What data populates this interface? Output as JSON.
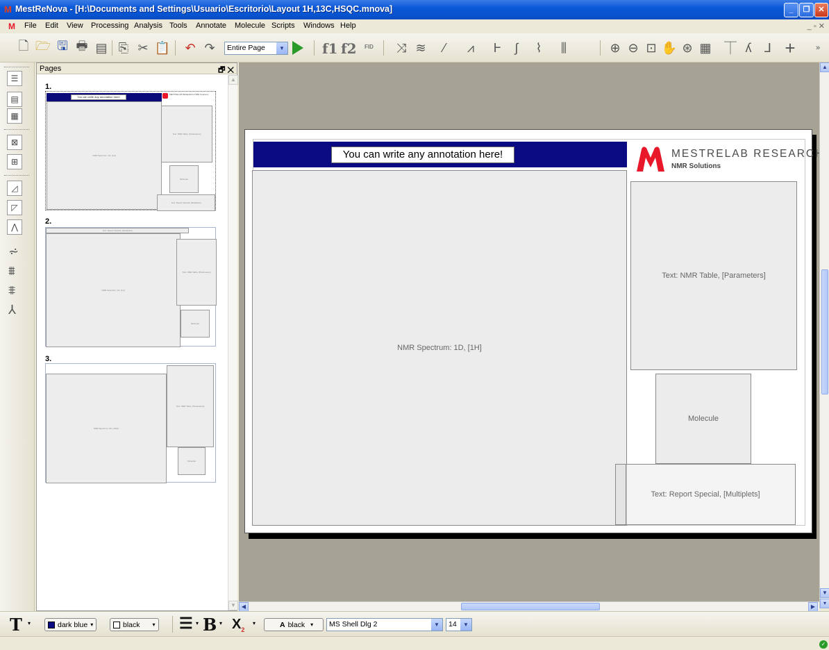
{
  "window": {
    "app_icon_glyph": "M",
    "title": "MestReNova - [H:\\Documents and Settings\\Usuario\\Escritorio\\Layout 1H,13C,HSQC.mnova]",
    "minimize_glyph": "_",
    "maximize_glyph": "❐",
    "close_glyph": "✕"
  },
  "menubar": {
    "items": [
      "File",
      "Edit",
      "View",
      "Processing",
      "Analysis",
      "Tools",
      "Annotate",
      "Molecule",
      "Scripts",
      "Windows",
      "Help"
    ],
    "mdi_controls": "_ ▫ ✕"
  },
  "toolbar": {
    "zoom_value": "Entire Page",
    "f1_label": "f1",
    "f2_label": "f2",
    "fid_label": "FID"
  },
  "pages_panel": {
    "title": "Pages",
    "controls": "🗗 ✕",
    "page_labels": [
      "1.",
      "2.",
      "3."
    ],
    "thumb_texts": {
      "annotation": "You can write any annotation here!",
      "spectrum": "NMR Spectrum: 1D, [1H]",
      "spectrum_2d": "NMR Spectrum: 2D, HSQC",
      "table": "Text: NMR Table, [Parameters]",
      "molecule": "Molecule",
      "report": "Text: Report Special, [Multiplets]",
      "logo": "MESTRELAB RESEARCH NMR Solutions"
    }
  },
  "document_page": {
    "annotation": "You can write any annotation here!",
    "logo_title": "MESTRELAB RESEARCH",
    "logo_subtitle": "NMR Solutions",
    "spectrum_label": "NMR Spectrum: 1D, [1H]",
    "table_label": "Text: NMR Table, [Parameters]",
    "molecule_label": "Molecule",
    "report_label": "Text: Report Special, [Multiplets]"
  },
  "formatbar": {
    "fill_color": "dark blue",
    "line_color": "black",
    "text_color": "black",
    "font_name": "MS Shell Dlg 2",
    "font_size": "14"
  },
  "colors": {
    "banner": "#0a0a82",
    "logo_red": "#e8172a",
    "canvas_bg": "#a6a394"
  }
}
